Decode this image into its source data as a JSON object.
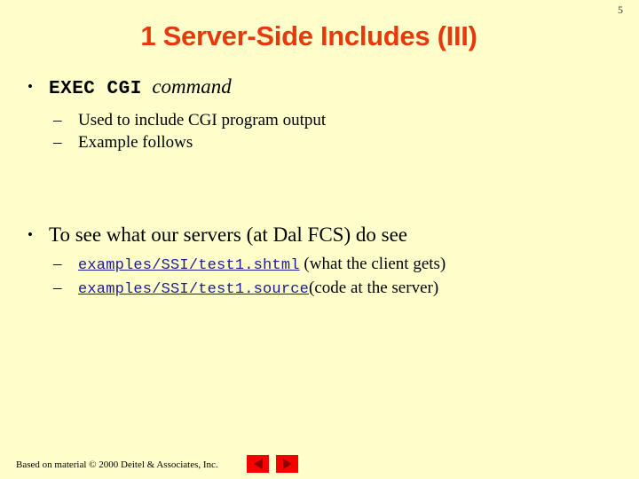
{
  "slide": {
    "background_color": "#ffffcc",
    "page_number": "5",
    "title": "1 Server-Side Includes (III)",
    "title_color": "#e8380d"
  },
  "body": {
    "bullet1": {
      "marker": "•",
      "code": "EXEC CGI",
      "italic": "command",
      "sub": [
        {
          "marker": "–",
          "text": "Used to include CGI program output"
        },
        {
          "marker": "–",
          "text": "Example follows"
        }
      ]
    },
    "bullet2": {
      "marker": "•",
      "text": "To see what our servers (at Dal FCS) do see",
      "sub": [
        {
          "marker": "–",
          "link": "examples/SSI/test1.shtml",
          "link_color": "#1b1b8f",
          "note": "(what the client gets)"
        },
        {
          "marker": "–",
          "link": "examples/SSI/test1.source",
          "link_color": "#1b1b8f",
          "note": "(code at the server)"
        }
      ]
    }
  },
  "footer": {
    "credit": "Based on material © 2000 Deitel & Associates, Inc.",
    "prev_button": "previous-slide",
    "next_button": "next-slide",
    "button_color": "#f80000",
    "arrow_color": "#8e0000"
  }
}
